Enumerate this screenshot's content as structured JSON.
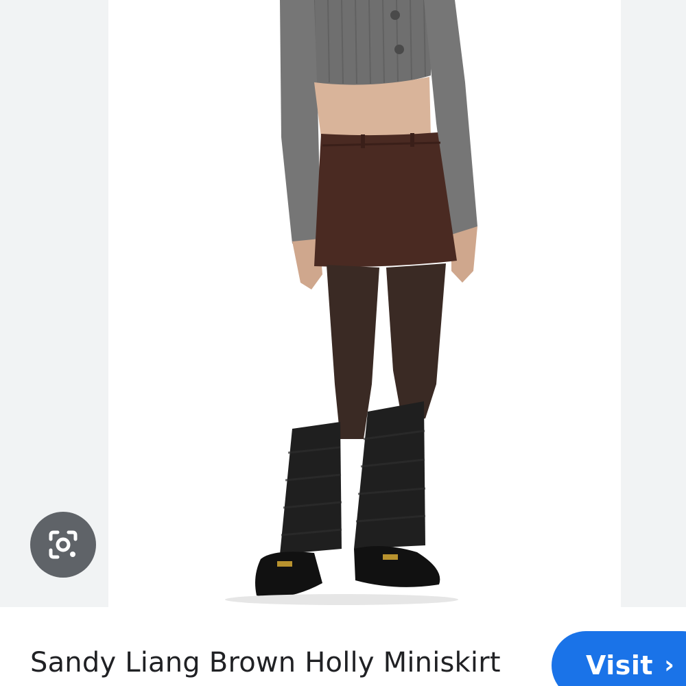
{
  "viewer": {
    "image_alt": "Sandy Liang Brown Holly Miniskirt product photo"
  },
  "lens": {
    "icon": "lens-camera-icon",
    "accent": "#5f6368"
  },
  "result": {
    "title": "Sandy Liang Brown Holly Miniskirt",
    "visit_label": "Visit",
    "visit_icon": "chevron-right-icon",
    "visit_color": "#1a73e8"
  }
}
